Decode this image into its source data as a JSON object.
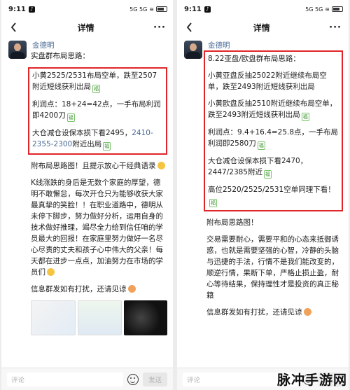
{
  "left": {
    "status": {
      "time": "9:11",
      "signal": "5G 5G",
      "network": "LTE LTE"
    },
    "nav": {
      "title": "详情"
    },
    "author": {
      "name": "金德明"
    },
    "post": {
      "intro": "实盘群布局思路：",
      "box": [
        "小黄2525/2531布局空单，跌至2507附近短线获利出局",
        "利润点：18+24=42点，一手布局利润即4200刀",
        "大仓减仓设保本损下看2495，"
      ],
      "phone": "2410-2355-2300",
      "phone_tail": "附近出局",
      "after": [
        "附布局思路图！且提示放心干经典语录",
        "K线涨跌的身后是无数个家庭的厚望，德明不敢懈怠，每次开仓只为能够收获大家最真挚的笑脸！！在职业道路中，德明从未停下脚步，努力做好分析，运用自身的技术做好推理，竭尽全力给到信任咱的学员最大的回报！在家庭里努力做好一名尽心尽责的丈夫和孩子心中伟大的父亲！每天都在进步一点点，加油努力在市场的学员们",
        "信息群发如有打扰，还请见谅"
      ]
    },
    "bottom": {
      "comment_placeholder": "评论",
      "send_label": "发送"
    }
  },
  "right": {
    "status": {
      "time": "9:11",
      "signal": "5G 5G",
      "network": "LTE LTE"
    },
    "nav": {
      "title": "详情"
    },
    "author": {
      "name": "金德明"
    },
    "post": {
      "box": [
        "8.22亚盘/欧盘群布局思路：",
        "小黄亚盘反抽25022附近继续布局空单，跌至2493附近短线获利出局",
        "小黄欧盘反抽2510附近继续布局空单，跌至2493附近短线获利出局",
        "利润点：9.4+16.4=25.8点，一手布局利润即2580刀",
        "大仓减仓设保本损下看2470，2447/2385附近",
        "高位2520/2525/2531空单同理下看！"
      ],
      "after": [
        "附布局思路图！",
        "交易需要耐心，需要平和的心态来抵御诱惑，也就是需要坚强的心智，冷静的头脑与迅捷的手法，行情不是我们能改变的，顺逆行情，果断下单，严格止损止盈，耐心等待结果，保持理性才是投资的真正秘籍",
        "信息群发如有打扰，还请见谅"
      ]
    },
    "bottom": {
      "comment_placeholder": "评论",
      "send_label": "发送"
    }
  },
  "watermark": "脉冲手游网",
  "colors": {
    "highlight_border": "#e0262a",
    "link": "#4a6b95"
  }
}
